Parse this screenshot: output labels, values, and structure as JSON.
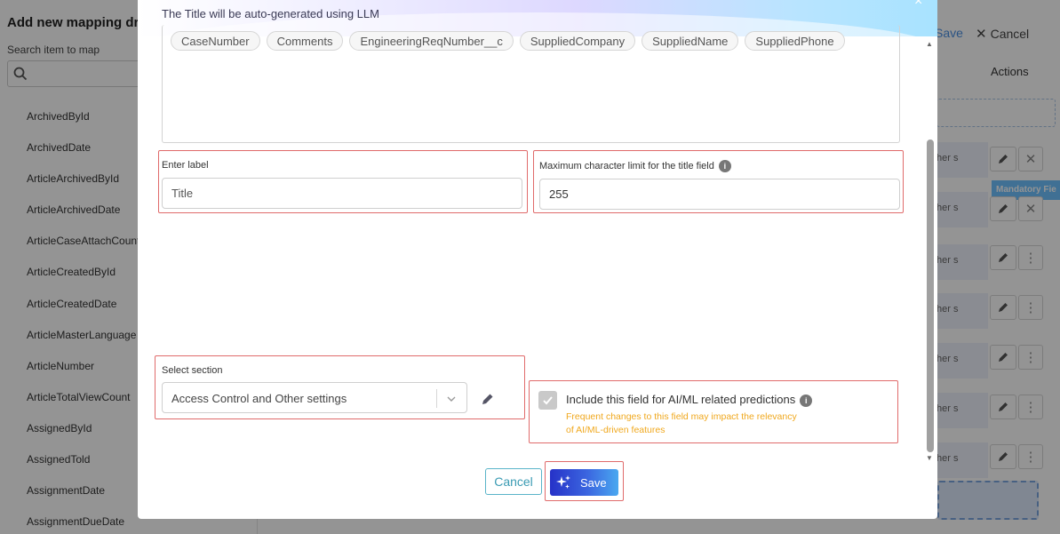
{
  "background": {
    "left_panel": {
      "title": "Add new mapping drag",
      "search_label": "Search item to map",
      "items": [
        "ArchivedById",
        "ArchivedDate",
        "ArticleArchivedById",
        "ArticleArchivedDate",
        "ArticleCaseAttachCount",
        "ArticleCreatedById",
        "ArticleCreatedDate",
        "ArticleMasterLanguage",
        "ArticleNumber",
        "ArticleTotalViewCount",
        "AssignedById",
        "AssignedTold",
        "AssignmentDate",
        "AssignmentDueDate"
      ]
    },
    "right_panel": {
      "save_label": "Save",
      "cancel_label": "Cancel",
      "actions_header": "Actions",
      "mandatory_badge": "Mandatory Fie",
      "row_text": "her s"
    }
  },
  "modal": {
    "banner_text": "The Title will be auto-generated using LLM",
    "close_symbol": "×",
    "tags": [
      "CaseNumber",
      "Comments",
      "EngineeringReqNumber__c",
      "SuppliedCompany",
      "SuppliedName",
      "SuppliedPhone"
    ],
    "label_field": {
      "label": "Enter label",
      "placeholder": "Title"
    },
    "char_limit_field": {
      "label": "Maximum character limit for the title field",
      "value": "255"
    },
    "section_field": {
      "label": "Select section",
      "value": "Access Control and Other settings"
    },
    "ai_checkbox": {
      "label": "Include this field for AI/ML related predictions",
      "checked": true,
      "warning_line1": "Frequent changes to this field may impact the relevancy",
      "warning_line2": "of AI/ML-driven features"
    },
    "buttons": {
      "cancel": "Cancel",
      "save": "Save"
    }
  }
}
